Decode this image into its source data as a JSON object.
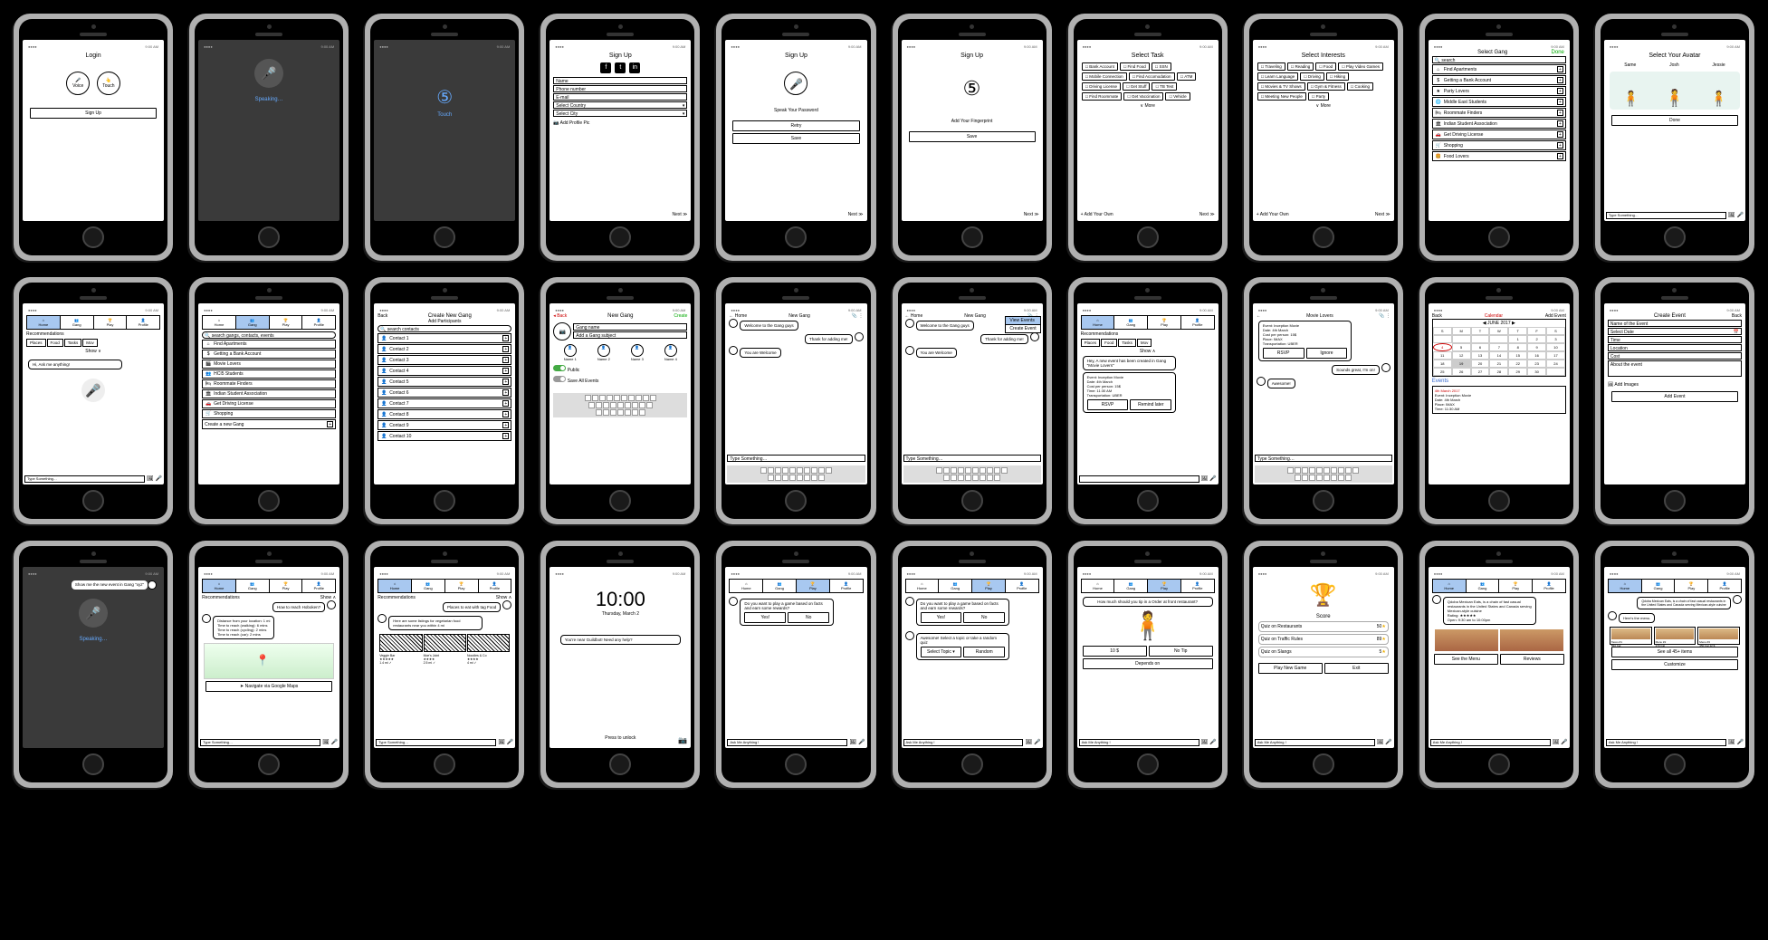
{
  "status": {
    "time": "9:00 AM"
  },
  "s1": {
    "title": "Login",
    "voice": "Voice",
    "touch": "Touch",
    "signup": "Sign Up"
  },
  "s2": {
    "speaking": "Speaking…"
  },
  "s3": {
    "touch": "Touch"
  },
  "s4": {
    "title": "Sign Up",
    "name": "Name",
    "phone": "Phone number",
    "email": "E-mail",
    "country": "Select Country",
    "city": "Select City",
    "addpic": "Add Profile Pic",
    "next": "Next ≫"
  },
  "s5": {
    "title": "Sign Up",
    "speak": "Speak Your Password",
    "retry": "Retry",
    "save": "Save",
    "next": "Next ≫"
  },
  "s6": {
    "title": "Sign Up",
    "add": "Add Your Fingerprint",
    "save": "Save",
    "next": "Next ≫"
  },
  "s7": {
    "title": "Select Task",
    "t": [
      "Bank Account",
      "Find Food",
      "SSN",
      "Mobile Connection",
      "Find Accomodation",
      "ATM",
      "Driving License",
      "Get Stuff",
      "TB Test",
      "Find Roommate",
      "Get Vaccination",
      "Vehicle"
    ],
    "more": "∨ More",
    "addown": "+ Add Your Own",
    "next": "Next ≫"
  },
  "s8": {
    "title": "Select Interests",
    "t": [
      "Traveling",
      "Reading",
      "Food",
      "Play Video Games",
      "Learn Language",
      "Driving",
      "Hiking",
      "Movies & TV Shows",
      "Gym & Fitness",
      "Cooking",
      "Meeting New People",
      "Party"
    ],
    "more": "∨ More",
    "addown": "+ Add Your Own",
    "next": "Next ≫"
  },
  "s9": {
    "title": "Select Gang",
    "done": "Done",
    "search": "🔍 search",
    "items": [
      {
        "i": "⌂",
        "n": "Find Apartments"
      },
      {
        "i": "$",
        "n": "Getting a Bank Account"
      },
      {
        "i": "★",
        "n": "Party Lovers"
      },
      {
        "i": "🌐",
        "n": "Middle East Students"
      },
      {
        "i": "🛏",
        "n": "Roommate Finders"
      },
      {
        "i": "🏛",
        "n": "Indian Student Association"
      },
      {
        "i": "🚗",
        "n": "Get Driving License"
      },
      {
        "i": "🛒",
        "n": "Shopping"
      },
      {
        "i": "🍔",
        "n": "Food Lovers"
      }
    ]
  },
  "s10": {
    "title": "Select Your Avatar",
    "av": [
      "Same",
      "Josh",
      "Jessie"
    ],
    "done": "Done",
    "type": "Type Something…"
  },
  "nav": {
    "home": "Home",
    "gang": "Gang",
    "play": "Play",
    "profile": "Profile"
  },
  "s11": {
    "rec": "Recommendations",
    "pills": [
      "Places",
      "Food",
      "Tasks",
      "Mov"
    ],
    "show": "Show ∨",
    "ask": "Hi, Ask me anything!",
    "type": "Type Something…"
  },
  "s12": {
    "search": "🔍 search gangs, contacts, events",
    "items": [
      {
        "i": "⌂",
        "n": "Find Apartments"
      },
      {
        "i": "$",
        "n": "Getting a Bank Account"
      },
      {
        "i": "🎬",
        "n": "Movie Lovers"
      },
      {
        "i": "👥",
        "n": "HCI5 Students"
      },
      {
        "i": "🛏",
        "n": "Roommate Finders"
      },
      {
        "i": "🏛",
        "n": "Indian Student Association"
      },
      {
        "i": "🚗",
        "n": "Get Driving License"
      },
      {
        "i": "🛒",
        "n": "Shopping"
      }
    ],
    "create": "Create a new Gang"
  },
  "s13": {
    "title": "Create New Gang",
    "sub": "Add Participants",
    "back": "Back",
    "search": "🔍 search contacts",
    "contacts": [
      "Contact 1",
      "Contact 2",
      "Contact 3",
      "Contact 4",
      "Contact 5",
      "Contact 6",
      "Contact 7",
      "Contact 8",
      "Contact 9",
      "Contact 10"
    ]
  },
  "s14": {
    "title": "New Gang",
    "back": "◂ Back",
    "create": "Create",
    "gname": "Gang name",
    "gsub": "Add a Gang subject",
    "names": [
      "Name 1",
      "Name 2",
      "Name 3",
      "Name 4"
    ],
    "public": "Public",
    "save": "Save All Events"
  },
  "s15": {
    "title": "New Gang",
    "m1": "Welcome to the Gang guys",
    "m2": "Thank for adding me!",
    "m3": "You are Welcome",
    "type": "Type Something…"
  },
  "s16": {
    "title": "New Gang",
    "menu1": "View Events",
    "menu2": "Create Event"
  },
  "s17": {
    "rec": "Recommendations",
    "pills": [
      "Places",
      "Food",
      "Tasks",
      "Mov"
    ],
    "show": "Show ∧",
    "event": "Hey, A new event has been created in Gang \"Movie Lovers\"",
    "det": "Event: Inception Movie\nDate: 4th March\nCost per person: 15$\nTime: 11:30 AM\nTransportation: UBER",
    "rsvp": "RSVP",
    "remind": "Remind later"
  },
  "s18": {
    "title": "Movie Lovers",
    "det": "Event: Inception Movie\nDate: 4th March\nCost per person: 15$\nPlace: IMAX\nTransportation: UBER",
    "rsvp": "RSVP",
    "ignore": "Ignore",
    "reply": "Sounds great, I'm on!",
    "aw": "Awesome!",
    "type": "Type Something…"
  },
  "s19": {
    "title": "Calendar",
    "back": "Back",
    "add": "Add Event",
    "month": "JUNE 2017",
    "days": [
      "S",
      "M",
      "T",
      "W",
      "T",
      "F",
      "S"
    ],
    "ev": "Events",
    "evdate": "4th March 2017",
    "evdet": "Event: Inception Movie\nDate: 4th March\nPlace: IMAX\nTime: 11:30 AM"
  },
  "s20": {
    "title": "Create Event",
    "back": "Back",
    "f": [
      "Name of the Event",
      "Select Date",
      "Time",
      "Location",
      "Cost",
      "About the event"
    ],
    "addimg": "Add Images",
    "addbtn": "Add Event"
  },
  "s21": {
    "m": "Show me the new event in Gang \"xyz\"",
    "spk": "Speaking…"
  },
  "s22": {
    "rec": "Recommendations",
    "show": "Show ∧",
    "q": "How to reach Hoboken?",
    "ans": "Distance from your location: 1 mi\nTime to reach (walking): 6 mins\nTime to reach (cycling): 2 mins\nTime to reach (car): 2 mins",
    "nav": "Navigate via Google Maps",
    "type": "Type Something…"
  },
  "s23": {
    "rec": "Recommendations",
    "show": "Show ∧",
    "q": "Places to eat with tag Food",
    "ans": "Here are some listings for vegetarian food restaurants near you within 4 mi",
    "r1": "Veggie Bar",
    "r2": "Moe's Joint",
    "r3": "Noodles & Co",
    "type": "Type Something…"
  },
  "s24": {
    "time": "10:00",
    "date": "Thursday, March 2",
    "msg": "You're near Guildbot! Need any help?",
    "unlock": "Press to unlock"
  },
  "s25": {
    "q": "Do you want to play a game based on facts and earn some rewards?",
    "yes": "Yes!",
    "no": "No",
    "ask": "Ask Me Anything !"
  },
  "s26": {
    "sel": "Awesome! Select a topic or take a random quiz",
    "topic": "Select Topic  ▾",
    "random": "Random"
  },
  "s27": {
    "q": "How much should you tip in a Order at front restaurant?",
    "a1": "10 $",
    "a2": "No Tip",
    "a3": "Depends on"
  },
  "s28": {
    "score": "Score",
    "r1": "Quiz on Restaurants",
    "v1": "50",
    "r2": "Quiz on Traffic Rules",
    "v2": "89",
    "r3": "Quiz on Slangs",
    "v3": "5",
    "play": "Play New Game",
    "exit": "Exit"
  },
  "s29": {
    "desc": "Qdoba Mexican Eats, is a chain of fast casual restaurants in the United States and Canada serving Mexican-style cuisine",
    "rating": "Rating: ★★★★★",
    "menu": "See the Menu",
    "reviews": "Reviews",
    "ask": "Ask Me Anything !"
  },
  "s30": {
    "intro": "Here's the menu.",
    "items": [
      {
        "n": "Tacos #1",
        "c": "550 Cal"
      },
      {
        "n": "Menu #2",
        "c": "270 Cal"
      },
      {
        "n": "Menu #3",
        "c": "450 Cal",
        "p": "12 $"
      }
    ],
    "seeall": "See all 45+ items",
    "cust": "Customize",
    "ask": "Ask Me Anything !"
  }
}
